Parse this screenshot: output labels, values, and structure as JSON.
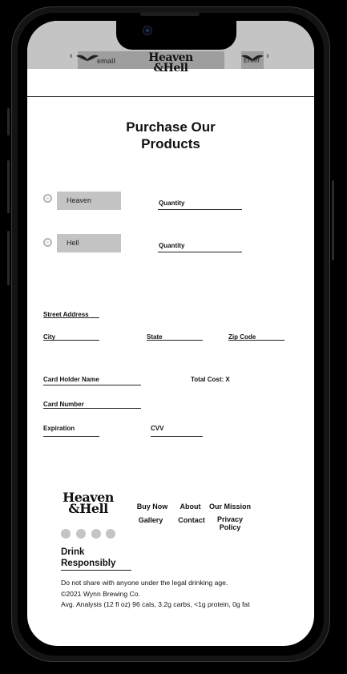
{
  "header": {
    "email_placeholder": "email",
    "enter_label": "Enter",
    "prev_glyph": "‹",
    "next_glyph": "›",
    "logo_line1": "Heaven",
    "logo_line2": "&Hell"
  },
  "page": {
    "title_line1": "Purchase Our",
    "title_line2": "Products"
  },
  "products": [
    {
      "name": "Heaven",
      "quantity_label": "Quantity"
    },
    {
      "name": "Hell",
      "quantity_label": "Quantity"
    }
  ],
  "form": {
    "street": "Street Address",
    "city": "City",
    "state": "State",
    "zip": "Zip Code",
    "card_holder": "Card Holder Name",
    "total_cost": "Total Cost: X",
    "card_number": "Card Number",
    "expiration": "Expiration",
    "cvv": "CVV"
  },
  "footer": {
    "logo_line1": "Heaven",
    "logo_line2": "&Hell",
    "links": {
      "buy_now": "Buy Now",
      "about": "About",
      "our_mission": "Our Mission",
      "gallery": "Gallery",
      "contact": "Contact",
      "privacy_line1": "Privacy",
      "privacy_line2": "Policy"
    },
    "social_icons": [
      "social-icon-1",
      "social-icon-2",
      "social-icon-3",
      "social-icon-4"
    ],
    "drink_line1": "Drink",
    "drink_line2": "Responsibly",
    "legal": [
      "Do not share with anyone under the legal drinking age.",
      "©2021 Wynn Brewing Co.",
      "Avg. Analysis (12 fl oz) 96 cals, 3.2g carbs, <1g protein, 0g fat"
    ]
  },
  "colors": {
    "placeholder_gray": "#c4c4c4",
    "text": "#111111",
    "background": "#ffffff"
  }
}
